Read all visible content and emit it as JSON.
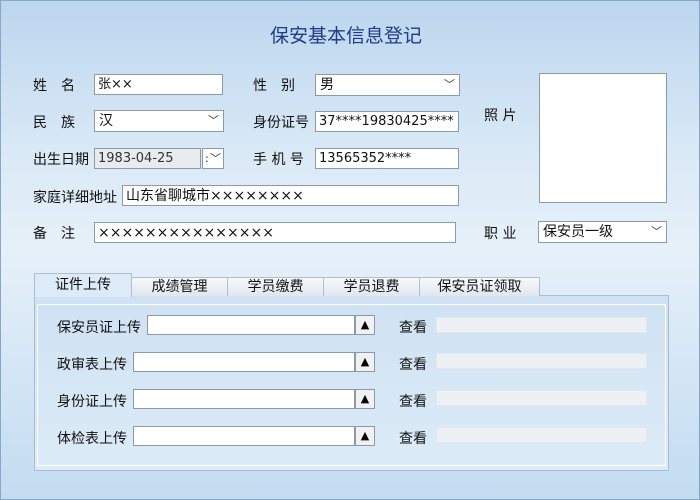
{
  "title": "保安基本信息登记",
  "fields": {
    "name": {
      "label": "姓　名",
      "value": "张××"
    },
    "gender": {
      "label": "性　别",
      "value": "男"
    },
    "ethnicity": {
      "label": "民　族",
      "value": "汉"
    },
    "id_number": {
      "label": "身份证号",
      "value": "37****19830425****"
    },
    "birth_date": {
      "label": "出生日期",
      "value": "1983-04-25"
    },
    "phone": {
      "label": "手 机 号",
      "value": "13565352****"
    },
    "address": {
      "label": "家庭详细地址",
      "value": "山东省聊城市××××××××"
    },
    "remarks": {
      "label": "备　注",
      "value": "×××××××××××××××"
    },
    "occupation": {
      "label": "职 业",
      "value": "保安员一级"
    }
  },
  "photo_label": "照 片",
  "tabs": [
    {
      "label": "证件上传",
      "active": true
    },
    {
      "label": "成绩管理",
      "active": false
    },
    {
      "label": "学员缴费",
      "active": false
    },
    {
      "label": "学员退费",
      "active": false
    },
    {
      "label": "保安员证领取",
      "active": false
    }
  ],
  "uploads": [
    {
      "label": "保安员证上传",
      "value": "",
      "view_label": "查看"
    },
    {
      "label": "政审表上传",
      "value": "",
      "view_label": "查看"
    },
    {
      "label": "身份证上传",
      "value": "",
      "view_label": "查看"
    },
    {
      "label": "体检表上传",
      "value": "",
      "view_label": "查看"
    }
  ],
  "icons": {
    "dropdown": "chevron-down-icon",
    "upload": "up-triangle-icon"
  }
}
